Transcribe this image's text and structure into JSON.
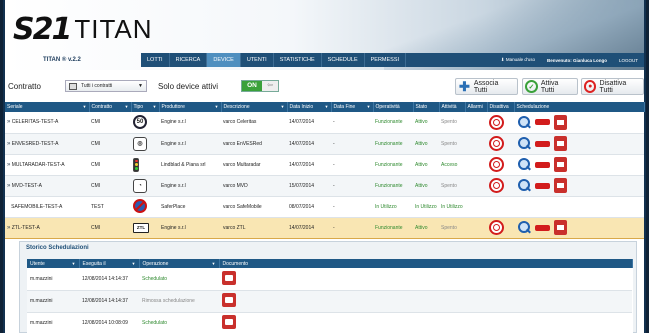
{
  "header": {
    "logo_s21": "S21",
    "logo_titan": "TITAN",
    "version": "TITAN ® v.2.2"
  },
  "nav": {
    "items": [
      "LOTTI",
      "RICERCA",
      "DEVICE",
      "UTENTI",
      "STATISTICHE",
      "SCHEDULE",
      "PERMESSI"
    ],
    "active": "DEVICE",
    "manual": "Manuale d'uso",
    "welcome": "Benvenuto: Gianluca Longo",
    "logout": "LOGOUT"
  },
  "toolbar": {
    "contratto_label": "Contratto",
    "contratto_value": "Tutti i contratti",
    "solo_label": "Solo device attivi",
    "toggle_on": "ON",
    "toggle_off": "⇦",
    "associa": "Associa Tutti",
    "attiva": "Attiva Tutti",
    "disattiva": "Disattiva Tutti"
  },
  "table": {
    "headers": [
      "Seriale",
      "Contratto",
      "Tipo",
      "Produttore",
      "Descrizione",
      "Data Inizio",
      "Data Fine",
      "Operatività",
      "Stato",
      "Attività",
      "Allarmi",
      "Disattiva",
      "Schedulazione"
    ],
    "rows": [
      {
        "seriale": "CELERITAS-TEST-A",
        "contratto": "CMI",
        "tipo": "50",
        "produttore": "Engine s.r.l",
        "descrizione": "varco Celeritas",
        "inizio": "14/07/2014",
        "fine": "-",
        "operativita": "Funzionante",
        "stato": "Attivo",
        "attivita": "Spento"
      },
      {
        "seriale": "ENVESRED-TEST-A",
        "contratto": "CMI",
        "tipo": "camera",
        "produttore": "Engine s.r.l",
        "descrizione": "varco EnVESRed",
        "inizio": "14/07/2014",
        "fine": "-",
        "operativita": "Funzionante",
        "stato": "Attivo",
        "attivita": "Spento"
      },
      {
        "seriale": "MULTARADAR-TEST-A",
        "contratto": "CMI",
        "tipo": "traffic-light",
        "produttore": "Lindblad & Piana srl",
        "descrizione": "varco Multaradar",
        "inizio": "14/07/2014",
        "fine": "-",
        "operativita": "Funzionante",
        "stato": "Attivo",
        "attivita": "Acceso"
      },
      {
        "seriale": "MVD-TEST-A",
        "contratto": "CMI",
        "tipo": "speedometer",
        "produttore": "Engine s.r.l",
        "descrizione": "varco MVD",
        "inizio": "15/07/2014",
        "fine": "-",
        "operativita": "Funzionante",
        "stato": "Attivo",
        "attivita": "Spento"
      },
      {
        "seriale": "SAFEMOBILE-TEST-A",
        "contratto": "TEST",
        "tipo": "no-parking",
        "produttore": "SaferPlace",
        "descrizione": "varco SafeMobile",
        "inizio": "08/07/2014",
        "fine": "-",
        "operativita": "In Utilizzo",
        "stato": "In Utilizzo",
        "attivita": "In Utilizzo"
      },
      {
        "seriale": "ZTL-TEST-A",
        "contratto": "CMI",
        "tipo": "ZTL",
        "produttore": "Engine s.r.l",
        "descrizione": "varco ZTL",
        "inizio": "14/07/2014",
        "fine": "-",
        "operativita": "Funzionante",
        "stato": "Attivo",
        "attivita": "Spento"
      }
    ]
  },
  "history": {
    "title": "Storico Schedulazioni",
    "headers": [
      "Utente",
      "Eseguita il",
      "Operazione",
      "Documento"
    ],
    "rows": [
      {
        "utente": "m.mazzini",
        "data": "12/08/2014 14:14:37",
        "operazione": "Schedulato"
      },
      {
        "utente": "m.mazzini",
        "data": "12/08/2014 14:14:37",
        "operazione": "Rimossa schedulazione"
      },
      {
        "utente": "m.mazzini",
        "data": "12/08/2014 10:08:09",
        "operazione": "Schedulato"
      }
    ]
  },
  "colors": {
    "nav": "#1f4f77",
    "header_row": "#1f5885",
    "green_status": "#2f8a2f",
    "selected_row": "#f9e6b3",
    "action_red": "#d21c1c"
  }
}
